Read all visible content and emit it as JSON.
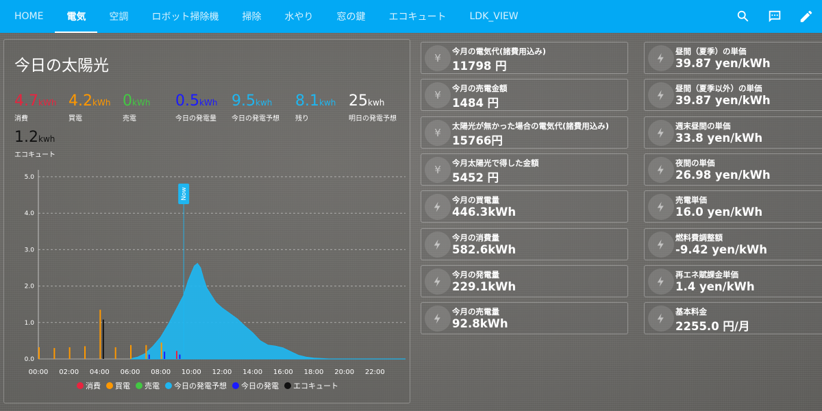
{
  "tabs": [
    {
      "label": "HOME",
      "active": false
    },
    {
      "label": "電気",
      "active": true
    },
    {
      "label": "空調",
      "active": false
    },
    {
      "label": "ロボット掃除機",
      "active": false
    },
    {
      "label": "掃除",
      "active": false
    },
    {
      "label": "水やり",
      "active": false
    },
    {
      "label": "窓の鍵",
      "active": false
    },
    {
      "label": "エコキュート",
      "active": false
    },
    {
      "label": "LDK_VIEW",
      "active": false
    }
  ],
  "top_icons": [
    "search-icon",
    "chat-icon",
    "pencil-icon"
  ],
  "solar": {
    "title": "今日の太陽光",
    "stats": [
      {
        "value": "4.7",
        "unit": "kWh",
        "label": "消費",
        "color": "#e8243f"
      },
      {
        "value": "4.2",
        "unit": "kWh",
        "label": "買電",
        "color": "#ff9800"
      },
      {
        "value": "0",
        "unit": "kWh",
        "label": "売電",
        "color": "#43c843"
      },
      {
        "value": "0.5",
        "unit": "kWh",
        "label": "今日の発電量",
        "color": "#1a1aff"
      },
      {
        "value": "9.5",
        "unit": "kwh",
        "label": "今日の発電予想",
        "color": "#1fb6f0"
      },
      {
        "value": "8.1",
        "unit": "kwh",
        "label": "残り",
        "color": "#1fb6f0"
      },
      {
        "value": "25",
        "unit": "kwh",
        "label": "明日の発電予想",
        "color": "#ffffff"
      },
      {
        "value": "1.2",
        "unit": "kwh",
        "label": "エコキュート",
        "color": "#111111"
      }
    ]
  },
  "chart_data": {
    "type": "line",
    "y_ticks": [
      "0.0",
      "1.0",
      "2.0",
      "3.0",
      "4.0",
      "5.0"
    ],
    "ylim": [
      0,
      5
    ],
    "x_ticks": [
      "00:00",
      "02:00",
      "04:00",
      "06:00",
      "08:00",
      "10:00",
      "12:00",
      "14:00",
      "16:00",
      "18:00",
      "20:00",
      "22:00"
    ],
    "xlim": [
      0,
      24
    ],
    "now_label": "Now",
    "now_hour": 9.5,
    "forecast": {
      "name": "今日の発電予想",
      "color": "#1fb6f0",
      "points": [
        [
          6.0,
          0
        ],
        [
          6.5,
          0.05
        ],
        [
          7.0,
          0.15
        ],
        [
          7.5,
          0.35
        ],
        [
          8.0,
          0.6
        ],
        [
          8.5,
          0.95
        ],
        [
          9.0,
          1.35
        ],
        [
          9.5,
          1.75
        ],
        [
          9.8,
          2.15
        ],
        [
          10.0,
          2.35
        ],
        [
          10.2,
          2.55
        ],
        [
          10.4,
          2.62
        ],
        [
          10.6,
          2.5
        ],
        [
          10.8,
          2.2
        ],
        [
          11.0,
          1.95
        ],
        [
          11.3,
          1.75
        ],
        [
          11.6,
          1.55
        ],
        [
          12.0,
          1.4
        ],
        [
          12.5,
          1.25
        ],
        [
          13.0,
          1.1
        ],
        [
          13.5,
          0.9
        ],
        [
          14.0,
          0.72
        ],
        [
          14.5,
          0.5
        ],
        [
          15.0,
          0.38
        ],
        [
          15.5,
          0.35
        ],
        [
          16.0,
          0.3
        ],
        [
          16.5,
          0.2
        ],
        [
          17.0,
          0.1
        ],
        [
          17.5,
          0.05
        ],
        [
          18.0,
          0.02
        ],
        [
          19.0,
          0
        ],
        [
          24.0,
          0
        ]
      ]
    },
    "bars": [
      {
        "series": "買電",
        "color": "#ff9800",
        "x": 0.0,
        "value": 0.32
      },
      {
        "series": "買電",
        "color": "#ff9800",
        "x": 1.0,
        "value": 0.3
      },
      {
        "series": "買電",
        "color": "#ff9800",
        "x": 2.0,
        "value": 0.32
      },
      {
        "series": "買電",
        "color": "#ff9800",
        "x": 3.0,
        "value": 0.35
      },
      {
        "series": "買電",
        "color": "#ff9800",
        "x": 4.0,
        "value": 1.35
      },
      {
        "series": "エコキュート",
        "color": "#111111",
        "x": 4.2,
        "value": 1.08
      },
      {
        "series": "買電",
        "color": "#ff9800",
        "x": 5.0,
        "value": 0.32
      },
      {
        "series": "買電",
        "color": "#ff9800",
        "x": 6.0,
        "value": 0.38
      },
      {
        "series": "買電",
        "color": "#ff9800",
        "x": 7.0,
        "value": 0.38
      },
      {
        "series": "今日の発電",
        "color": "#1a1aff",
        "x": 7.2,
        "value": 0.12
      },
      {
        "series": "買電",
        "color": "#ff9800",
        "x": 8.0,
        "value": 0.45
      },
      {
        "series": "今日の発電",
        "color": "#1a1aff",
        "x": 8.2,
        "value": 0.2
      },
      {
        "series": "消費",
        "color": "#e8243f",
        "x": 9.0,
        "value": 0.22
      },
      {
        "series": "今日の発電",
        "color": "#1a1aff",
        "x": 9.2,
        "value": 0.12
      }
    ]
  },
  "legend": [
    {
      "label": "消費",
      "color": "#e8243f"
    },
    {
      "label": "買電",
      "color": "#ff9800"
    },
    {
      "label": "売電",
      "color": "#43c843"
    },
    {
      "label": "今日の発電予想",
      "color": "#1fb6f0"
    },
    {
      "label": "今日の発電",
      "color": "#1a1aff"
    },
    {
      "label": "エコキュート",
      "color": "#111111"
    }
  ],
  "cards_left": [
    {
      "name": "今月の電気代(諸費用込み)",
      "value": "11798 円",
      "icon": "yen-icon"
    },
    {
      "name": "今月の売電金額",
      "value": "1484 円",
      "icon": "yen-icon"
    },
    {
      "name": "太陽光が無かった場合の電気代(諸費用込み)",
      "value": "15766円",
      "icon": "yen-icon"
    },
    {
      "name": "今月太陽光で得した金額",
      "value": "5452 円",
      "icon": "yen-icon"
    },
    {
      "name": "今月の買電量",
      "value": "446.3kWh",
      "icon": "flash-icon"
    },
    {
      "name": "今月の消費量",
      "value": "582.6kWh",
      "icon": "flash-icon"
    },
    {
      "name": "今月の発電量",
      "value": "229.1kWh",
      "icon": "flash-icon"
    },
    {
      "name": "今月の売電量",
      "value": "92.8kWh",
      "icon": "flash-icon"
    }
  ],
  "cards_right": [
    {
      "name": "昼間（夏季）の単価",
      "value": "39.87 yen/kWh",
      "icon": "flash-icon"
    },
    {
      "name": "昼間（夏季以外）の単価",
      "value": "39.87 yen/kWh",
      "icon": "flash-icon"
    },
    {
      "name": "週末昼間の単価",
      "value": "33.8 yen/kWh",
      "icon": "flash-icon"
    },
    {
      "name": "夜間の単価",
      "value": "26.98 yen/kWh",
      "icon": "flash-icon"
    },
    {
      "name": "売電単価",
      "value": "16.0 yen/kWh",
      "icon": "flash-icon"
    },
    {
      "name": "燃料費調整額",
      "value": "-9.42 yen/kWh",
      "icon": "flash-icon"
    },
    {
      "name": "再エネ賦課金単価",
      "value": "1.4 yen/kWh",
      "icon": "flash-icon"
    },
    {
      "name": "基本料金",
      "value": "2255.0 円/月",
      "icon": "flash-icon"
    }
  ]
}
